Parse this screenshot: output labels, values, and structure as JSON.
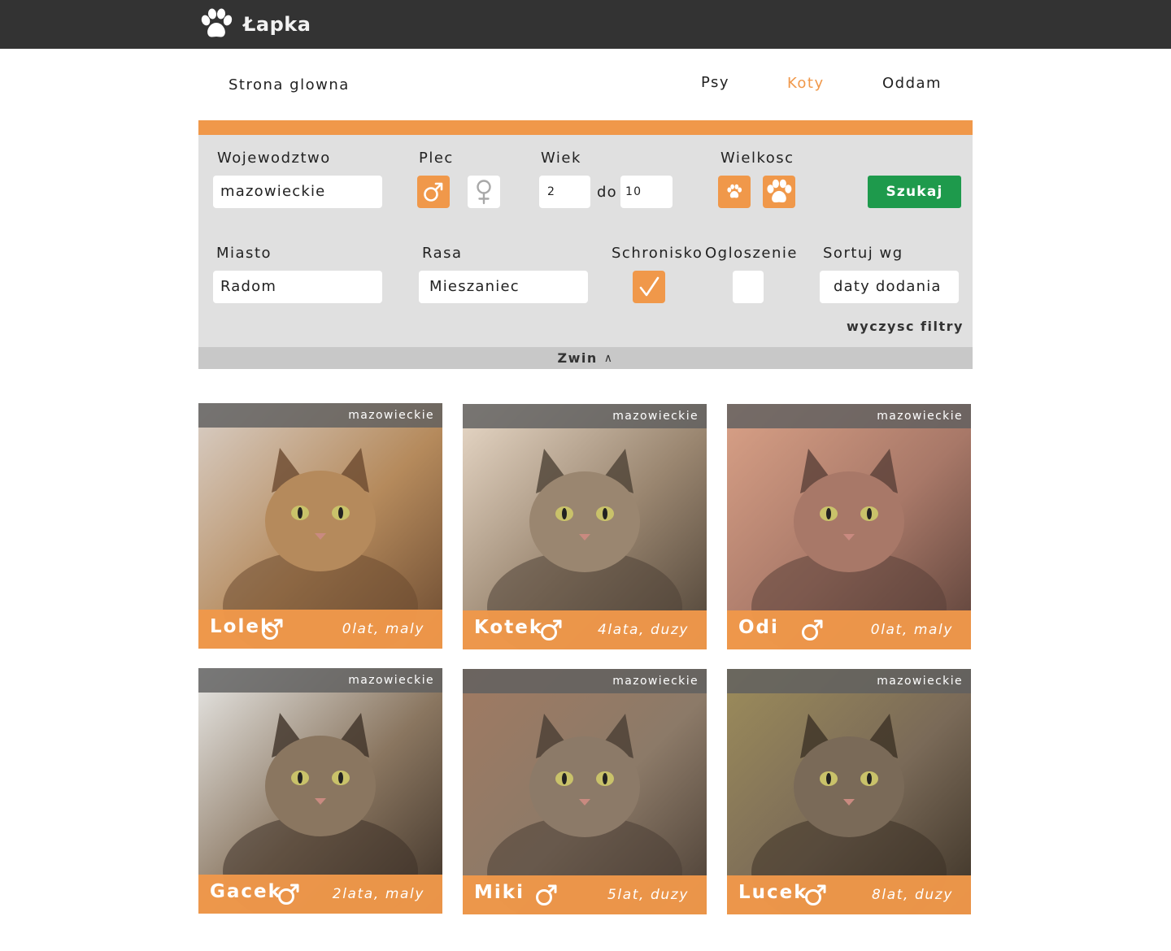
{
  "app": {
    "name": "Łapka",
    "accent": "#f0984a",
    "topbar_color": "#333333",
    "button_color": "#1e9a4c"
  },
  "nav": {
    "home": "Strona glowna",
    "items": [
      {
        "label": "Psy",
        "active": false
      },
      {
        "label": "Koty",
        "active": true
      },
      {
        "label": "Oddam",
        "active": false
      }
    ]
  },
  "filters": {
    "wojewodztwo_label": "Wojewodztwo",
    "wojewodztwo_value": "mazowieckie",
    "plec_label": "Plec",
    "plec_male_selected": true,
    "plec_female_selected": false,
    "wiek_label": "Wiek",
    "wiek_from": "2",
    "wiek_to_label": "do",
    "wiek_to": "10",
    "wielkosc_label": "Wielkosc",
    "szukaj_label": "Szukaj",
    "miasto_label": "Miasto",
    "miasto_value": "Radom",
    "rasa_label": "Rasa",
    "rasa_value": "Mieszaniec",
    "schronisko_label": "Schronisko",
    "schronisko_checked": true,
    "ogloszenie_label": "Ogloszenie",
    "ogloszenie_checked": false,
    "sortuj_label": "Sortuj wg",
    "sortuj_value": "daty dodania",
    "clear_label": "wyczysc filtry",
    "collapse_label": "Zwin",
    "collapse_icon": "caret-up-icon"
  },
  "cards": [
    {
      "region": "mazowieckie",
      "name": "Lolek",
      "sex": "male",
      "meta": "0lat, maly",
      "photo_colors": [
        "#d9cfc7",
        "#b58a5c",
        "#6b4a30"
      ]
    },
    {
      "region": "mazowieckie",
      "name": "Kotek",
      "sex": "male",
      "meta": "4lata, duzy",
      "photo_colors": [
        "#e8d9c8",
        "#9a8670",
        "#4e4236"
      ]
    },
    {
      "region": "mazowieckie",
      "name": "Odi",
      "sex": "male",
      "meta": "0lat, maly",
      "photo_colors": [
        "#d9a187",
        "#a87868",
        "#5a4038"
      ]
    },
    {
      "region": "mazowieckie",
      "name": "Gacek",
      "sex": "male",
      "meta": "2lata, maly",
      "photo_colors": [
        "#e8e8e6",
        "#8a7660",
        "#3e3228"
      ]
    },
    {
      "region": "mazowieckie",
      "name": "Miki",
      "sex": "male",
      "meta": "5lat, duzy",
      "photo_colors": [
        "#a07a62",
        "#8c7a68",
        "#4a3e34"
      ]
    },
    {
      "region": "mazowieckie",
      "name": "Lucek",
      "sex": "male",
      "meta": "8lat, duzy",
      "photo_colors": [
        "#9c8c5a",
        "#7a6a58",
        "#3c3226"
      ]
    }
  ]
}
